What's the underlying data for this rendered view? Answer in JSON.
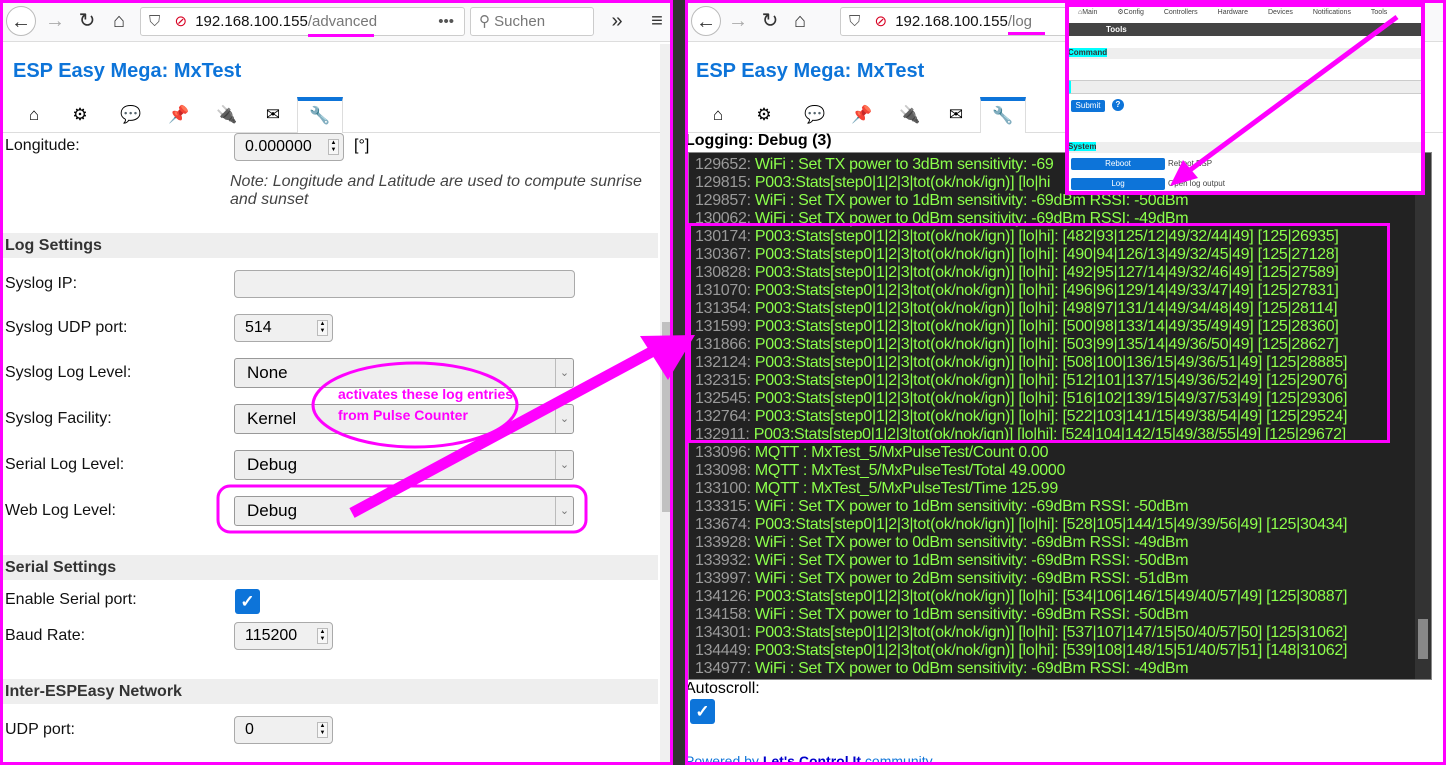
{
  "left": {
    "browser": {
      "url_host": "192.168.100.155",
      "url_path": "/advanced",
      "search_placeholder": "Suchen",
      "more": "•••"
    },
    "title": "ESP Easy Mega: MxTest",
    "tabs": [
      "⌂",
      "⚙",
      "💬",
      "📌",
      "🔌",
      "✉",
      "🔧"
    ],
    "longitude": {
      "label": "Longitude:",
      "value": "0.000000",
      "unit": "[°]"
    },
    "note": "Note: Longitude and Latitude are used to compute sunrise and sunset",
    "log_settings": {
      "header": "Log Settings",
      "syslog_ip": {
        "label": "Syslog IP:",
        "value": ""
      },
      "syslog_udp_port": {
        "label": "Syslog UDP port:",
        "value": "514"
      },
      "syslog_log_level": {
        "label": "Syslog Log Level:",
        "value": "None"
      },
      "syslog_facility": {
        "label": "Syslog Facility:",
        "value": "Kernel"
      },
      "serial_log_level": {
        "label": "Serial Log Level:",
        "value": "Debug"
      },
      "web_log_level": {
        "label": "Web Log Level:",
        "value": "Debug"
      }
    },
    "serial_settings": {
      "header": "Serial Settings",
      "enable_serial": {
        "label": "Enable Serial port:",
        "checked": true
      },
      "baud_rate": {
        "label": "Baud Rate:",
        "value": "115200"
      }
    },
    "inter_esp": {
      "header": "Inter-ESPEasy Network",
      "udp_port": {
        "label": "UDP port:",
        "value": "0"
      }
    }
  },
  "annotation": {
    "text1": "activates these log entries",
    "text2": "from Pulse Counter",
    "color": "#ff00ff"
  },
  "right": {
    "browser": {
      "url_host": "192.168.100.155",
      "url_path": "/log"
    },
    "title": "ESP Easy Mega: MxTest",
    "logging_title": "Logging: Debug (3)",
    "log_lines": [
      [
        "129652:",
        "WiFi : Set TX power to 3dBm sensitivity: -69"
      ],
      [
        "129815:",
        "P003:Stats[step0|1|2|3|tot(ok/nok/ign)] [lo|hi"
      ],
      [
        "129857:",
        "WiFi : Set TX power to 1dBm sensitivity: -69dBm RSSI: -50dBm"
      ],
      [
        "130062:",
        "WiFi : Set TX power to 0dBm sensitivity: -69dBm RSSI: -49dBm"
      ],
      [
        "130174:",
        "P003:Stats[step0|1|2|3|tot(ok/nok/ign)] [lo|hi]: [482|93|125/12|49/32/44|49] [125|26935]"
      ],
      [
        "130367:",
        "P003:Stats[step0|1|2|3|tot(ok/nok/ign)] [lo|hi]: [490|94|126/13|49/32/45|49] [125|27128]"
      ],
      [
        "130828:",
        "P003:Stats[step0|1|2|3|tot(ok/nok/ign)] [lo|hi]: [492|95|127/14|49/32/46|49] [125|27589]"
      ],
      [
        "131070:",
        "P003:Stats[step0|1|2|3|tot(ok/nok/ign)] [lo|hi]: [496|96|129/14|49/33/47|49] [125|27831]"
      ],
      [
        "131354:",
        "P003:Stats[step0|1|2|3|tot(ok/nok/ign)] [lo|hi]: [498|97|131/14|49/34/48|49] [125|28114]"
      ],
      [
        "131599:",
        "P003:Stats[step0|1|2|3|tot(ok/nok/ign)] [lo|hi]: [500|98|133/14|49/35/49|49] [125|28360]"
      ],
      [
        "131866:",
        "P003:Stats[step0|1|2|3|tot(ok/nok/ign)] [lo|hi]: [503|99|135/14|49/36/50|49] [125|28627]"
      ],
      [
        "132124:",
        "P003:Stats[step0|1|2|3|tot(ok/nok/ign)] [lo|hi]: [508|100|136/15|49/36/51|49] [125|28885]"
      ],
      [
        "132315:",
        "P003:Stats[step0|1|2|3|tot(ok/nok/ign)] [lo|hi]: [512|101|137/15|49/36/52|49] [125|29076]"
      ],
      [
        "132545:",
        "P003:Stats[step0|1|2|3|tot(ok/nok/ign)] [lo|hi]: [516|102|139/15|49/37/53|49] [125|29306]"
      ],
      [
        "132764:",
        "P003:Stats[step0|1|2|3|tot(ok/nok/ign)] [lo|hi]: [522|103|141/15|49/38/54|49] [125|29524]"
      ],
      [
        "132911:",
        "P003:Stats[step0|1|2|3|tot(ok/nok/ign)] [lo|hi]: [524|104|142/15|49/38/55|49] [125|29672]"
      ],
      [
        "133096:",
        "MQTT : MxTest_5/MxPulseTest/Count 0.00"
      ],
      [
        "133098:",
        "MQTT : MxTest_5/MxPulseTest/Total 49.0000"
      ],
      [
        "133100:",
        "MQTT : MxTest_5/MxPulseTest/Time 125.99"
      ],
      [
        "133315:",
        "WiFi : Set TX power to 1dBm sensitivity: -69dBm RSSI: -50dBm"
      ],
      [
        "133674:",
        "P003:Stats[step0|1|2|3|tot(ok/nok/ign)] [lo|hi]: [528|105|144/15|49/39/56|49] [125|30434]"
      ],
      [
        "133928:",
        "WiFi : Set TX power to 0dBm sensitivity: -69dBm RSSI: -49dBm"
      ],
      [
        "133932:",
        "WiFi : Set TX power to 1dBm sensitivity: -69dBm RSSI: -50dBm"
      ],
      [
        "133997:",
        "WiFi : Set TX power to 2dBm sensitivity: -69dBm RSSI: -51dBm"
      ],
      [
        "134126:",
        "P003:Stats[step0|1|2|3|tot(ok/nok/ign)] [lo|hi]: [534|106|146/15|49/40/57|49] [125|30887]"
      ],
      [
        "134158:",
        "WiFi : Set TX power to 1dBm sensitivity: -69dBm RSSI: -50dBm"
      ],
      [
        "134301:",
        "P003:Stats[step0|1|2|3|tot(ok/nok/ign)] [lo|hi]: [537|107|147/15|50/40/57|50] [125|31062]"
      ],
      [
        "134449:",
        "P003:Stats[step0|1|2|3|tot(ok/nok/ign)] [lo|hi]: [539|108|148/15|51/40/57|51] [148|31062]"
      ],
      [
        "134977:",
        "WiFi : Set TX power to 0dBm sensitivity: -69dBm RSSI: -49dBm"
      ]
    ],
    "autoscroll": {
      "label": "Autoscroll:",
      "checked": true
    },
    "footer": {
      "prefix": "Powered by ",
      "link": "Let's Control It",
      "suffix": " community"
    }
  },
  "inset": {
    "menu": [
      "⌂Main",
      "⚙Config",
      "Controllers",
      "Hardware",
      "Devices",
      "Notifications",
      "Tools"
    ],
    "bar_title": "Tools",
    "command_label": "Command",
    "submit": "Submit",
    "help": "?",
    "system_label": "System",
    "reboot": "Reboot",
    "reboot_desc": "Reboot ESP",
    "log": "Log",
    "log_desc": "Open log output"
  }
}
